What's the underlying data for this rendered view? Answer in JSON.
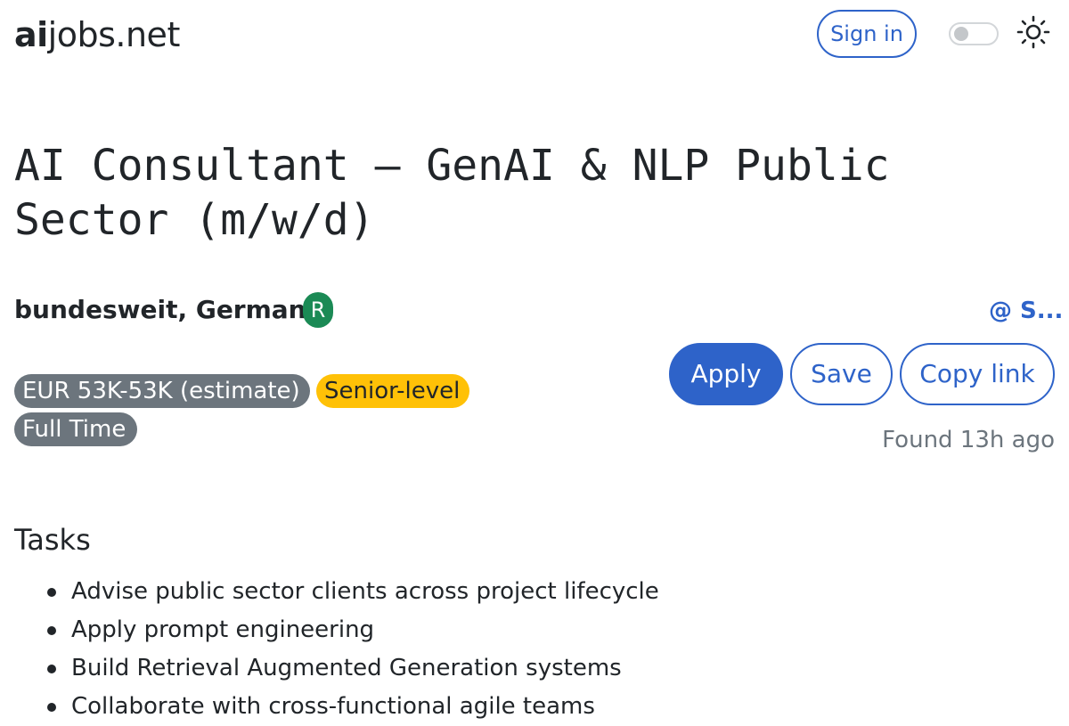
{
  "header": {
    "logo_bold": "ai",
    "logo_rest": "jobs.net",
    "sign_in_label": "Sign in",
    "theme_toggle_state": "off",
    "theme_icon": "sun-icon"
  },
  "job": {
    "title": "AI Consultant – GenAI & NLP Public Sector (m/w/d)",
    "location": "bundesweit, Germany",
    "remote_badge": "R",
    "company": "@ S...",
    "badges": {
      "salary": "EUR 53K-53K (estimate)",
      "level": "Senior-level",
      "type": "Full Time"
    },
    "actions": {
      "apply": "Apply",
      "save": "Save",
      "copy_link": "Copy link"
    },
    "found": "Found 13h ago"
  },
  "tasks": {
    "title": "Tasks",
    "items": [
      "Advise public sector clients across project lifecycle",
      "Apply prompt engineering",
      "Build Retrieval Augmented Generation systems",
      "Collaborate with cross-functional agile teams"
    ]
  },
  "colors": {
    "accent": "#2e63c9",
    "badge_gray": "#6c757d",
    "badge_yellow": "#ffc107",
    "remote_green": "#1b8a55"
  }
}
